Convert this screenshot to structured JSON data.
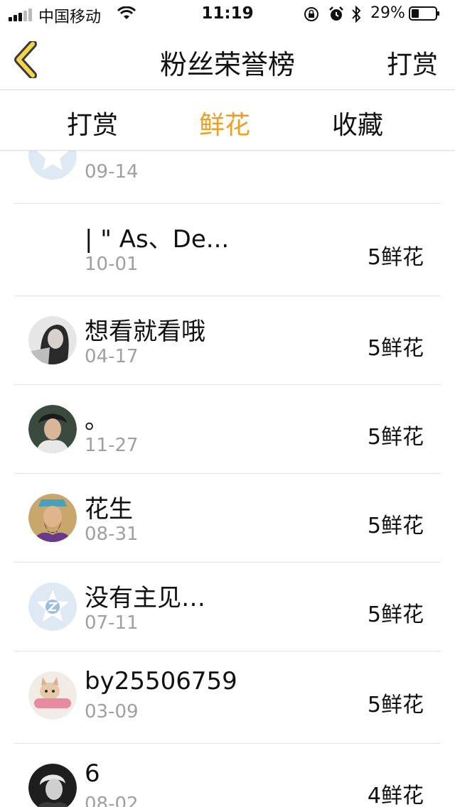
{
  "status_bar": {
    "carrier": "中国移动",
    "time": "11:19",
    "battery_percent": "29%"
  },
  "nav": {
    "title": "粉丝荣誉榜",
    "action_label": "打赏"
  },
  "tabs": [
    {
      "label": "打赏",
      "active": false
    },
    {
      "label": "鲜花",
      "active": true
    },
    {
      "label": "收藏",
      "active": false
    }
  ],
  "accent_color": "#f0a020",
  "list": [
    {
      "name": "",
      "date": "09-14",
      "amount": "",
      "avatar": "qq-default-icon"
    },
    {
      "name": "| \" As、De...",
      "date": "10-01",
      "amount": "5鲜花",
      "avatar": "none"
    },
    {
      "name": "想看就看哦",
      "date": "04-17",
      "amount": "5鲜花",
      "avatar": "avatar-photo"
    },
    {
      "name": "。",
      "date": "11-27",
      "amount": "5鲜花",
      "avatar": "avatar-photo"
    },
    {
      "name": "花生",
      "date": "08-31",
      "amount": "5鲜花",
      "avatar": "avatar-photo"
    },
    {
      "name": "没有主见…",
      "date": "07-11",
      "amount": "5鲜花",
      "avatar": "qq-default-icon"
    },
    {
      "name": "by25506759",
      "date": "03-09",
      "amount": "5鲜花",
      "avatar": "avatar-photo"
    },
    {
      "name": "6",
      "date": "08-02",
      "amount": "4鲜花",
      "avatar": "avatar-photo"
    }
  ]
}
